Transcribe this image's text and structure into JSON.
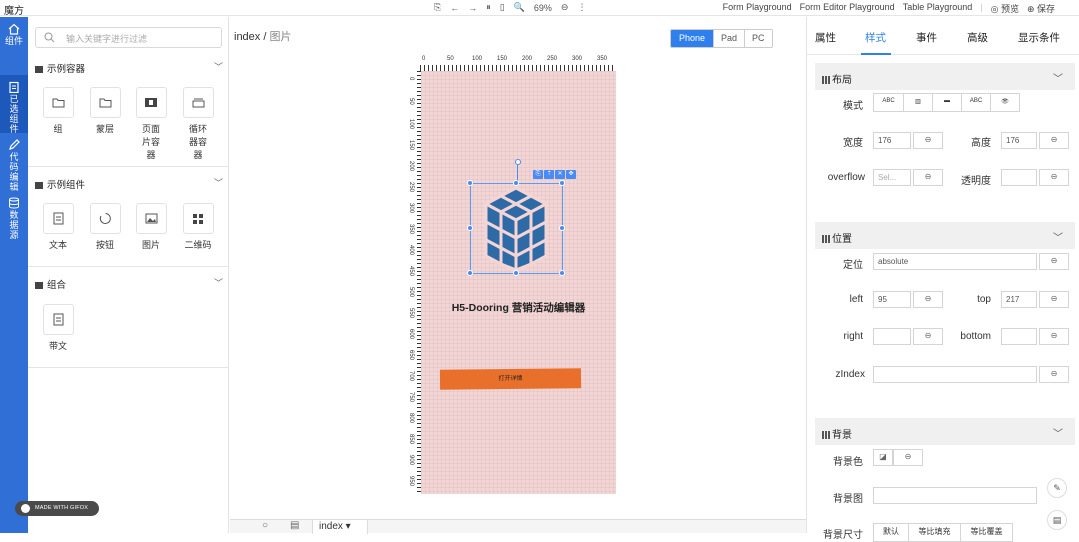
{
  "app": {
    "title": "魔方"
  },
  "topbar": {
    "center_tools": [
      "⎘",
      "←",
      "→",
      "⏸",
      "▯",
      "🔍",
      "69%",
      "⊖",
      "⋮"
    ],
    "right_links": [
      "Form Playground",
      "Form Editor Playground",
      "Table Playground"
    ],
    "preview": "◎ 预览",
    "save": "⊕ 保存"
  },
  "leftbar": {
    "items": [
      {
        "label": "组件"
      },
      {
        "label": "已选组件"
      },
      {
        "label": "代码编辑"
      },
      {
        "label": "数据源"
      }
    ]
  },
  "panel": {
    "search_placeholder": "输入关键字进行过滤",
    "sections": [
      {
        "title": "示例容器",
        "items": [
          "组",
          "蒙层",
          "页面片容器",
          "循环器容器"
        ]
      },
      {
        "title": "示例组件",
        "items": [
          "文本",
          "按钮",
          "图片",
          "二维码"
        ]
      },
      {
        "title": "组合",
        "items": [
          "带文"
        ]
      }
    ]
  },
  "canvas": {
    "breadcrumb_root": "index",
    "breadcrumb_sep": " / ",
    "breadcrumb_current": "图片",
    "devices": [
      "Phone",
      "Pad",
      "PC"
    ],
    "active_device": "Phone",
    "phone_title": "H5-Dooring 营销活动编辑器",
    "phone_button": "打开详情",
    "mini_tools": [
      "⎘",
      "⇡",
      "✕",
      "✥"
    ],
    "bottom_tab": "index ▾",
    "madeby": "MADE WITH GIFOX",
    "ruler_top": [
      "0",
      "50",
      "100",
      "150",
      "200",
      "250",
      "300",
      "350"
    ],
    "ruler_left": [
      "0",
      "50",
      "100",
      "150",
      "200",
      "250",
      "300",
      "350",
      "400",
      "450",
      "500",
      "550",
      "600",
      "650",
      "700",
      "750",
      "800",
      "850",
      "900",
      "950"
    ]
  },
  "rpanel": {
    "tabs": [
      "属性",
      "样式",
      "事件",
      "高级",
      "显示条件"
    ],
    "active_tab": "样式",
    "layout": {
      "title": "布局",
      "mode_label": "模式",
      "mode_options": [
        "ABC",
        "▥",
        "▬",
        "ABC",
        "👁"
      ],
      "width_label": "宽度",
      "width": "176",
      "height_label": "高度",
      "height": "176",
      "overflow_label": "overflow",
      "overflow_placeholder": "Sel...",
      "opacity_label": "透明度"
    },
    "position": {
      "title": "位置",
      "pos_label": "定位",
      "pos_value": "absolute",
      "left_label": "left",
      "left": "95",
      "top_label": "top",
      "top": "217",
      "right_label": "right",
      "bottom_label": "bottom",
      "zindex_label": "zIndex"
    },
    "background": {
      "title": "背景",
      "color_label": "背景色",
      "image_label": "背景图",
      "size_label": "背景尺寸",
      "size_options": [
        "默认",
        "等比填充",
        "等比覆盖"
      ]
    }
  },
  "colors": {
    "accent": "#2f80ed",
    "sidebar": "#2f6fd6",
    "phone_bg": "#f3d5d5",
    "cube": "#2e6aa6",
    "button": "#e8702a"
  }
}
